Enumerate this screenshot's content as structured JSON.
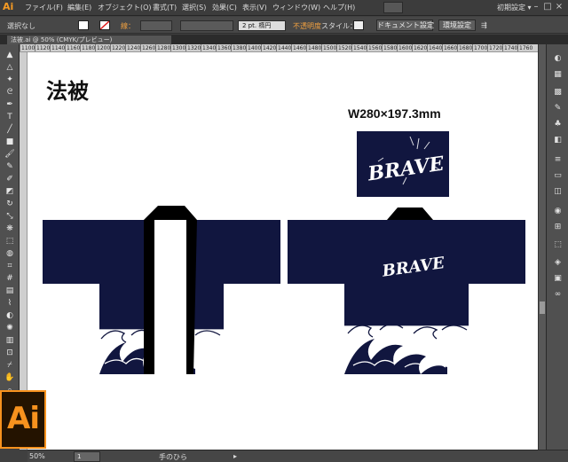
{
  "app": {
    "logo": "Ai",
    "splash_logo": "Ai"
  },
  "menubar": {
    "items": [
      "ファイル(F)",
      "編集(E)",
      "オブジェクト(O)",
      "書式(T)",
      "選択(S)",
      "効果(C)",
      "表示(V)",
      "ウィンドウ(W)",
      "ヘルプ(H)"
    ],
    "workspace": "初期設定 ▾"
  },
  "control": {
    "selection": "選択なし",
    "stroke_label": "線：",
    "stroke_weight": "2 pt. 楕円",
    "opacity_label": "不透明度",
    "style_label": "スタイル：",
    "doc_settings": "ドキュメント設定",
    "env_settings": "環境設定"
  },
  "document_tab": {
    "title": "法被.ai @ 50% (CMYK/プレビュー)"
  },
  "ruler": {
    "ticks": [
      "1100",
      "1120",
      "1140",
      "1160",
      "1180",
      "1200",
      "1220",
      "1240",
      "1260",
      "1280",
      "1300",
      "1320",
      "1340",
      "1360",
      "1380",
      "1400",
      "1420",
      "1440",
      "1460",
      "1480",
      "1500",
      "1520",
      "1540",
      "1560",
      "1580",
      "1600",
      "1620",
      "1640",
      "1660",
      "1680",
      "1700",
      "1720",
      "1740",
      "1760"
    ]
  },
  "artboard": {
    "title": "法被",
    "dimensions": "W280×197.3mm",
    "logo_text": "BRAVE"
  },
  "colors": {
    "navy": "#11163f",
    "accent": "#f7921e"
  },
  "status": {
    "zoom": "50%",
    "page": "1",
    "tool": "手のひら"
  },
  "icons": {
    "tool_icons": [
      "selection-icon",
      "direct-selection-icon",
      "magic-wand-icon",
      "lasso-icon",
      "pen-icon",
      "type-icon",
      "line-icon",
      "rectangle-icon",
      "paintbrush-icon",
      "pencil-icon",
      "blob-brush-icon",
      "eraser-icon",
      "rotate-icon",
      "scale-icon",
      "warp-icon",
      "free-transform-icon",
      "shape-builder-icon",
      "perspective-icon",
      "mesh-icon",
      "gradient-icon",
      "eyedropper-icon",
      "blend-icon",
      "symbol-sprayer-icon",
      "graph-icon",
      "artboard-icon",
      "slice-icon",
      "hand-icon",
      "zoom-icon"
    ]
  }
}
